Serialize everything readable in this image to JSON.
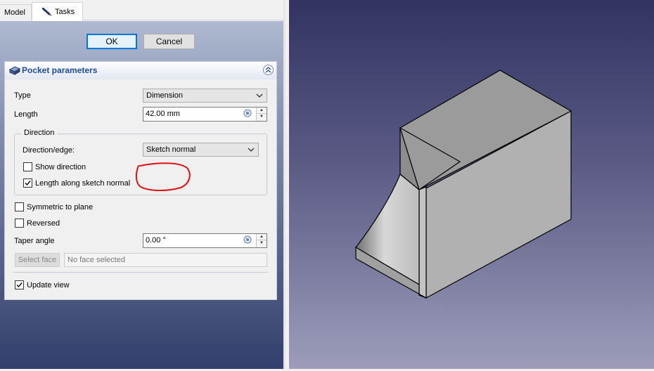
{
  "tabs": {
    "model_label": "Model",
    "tasks_label": "Tasks"
  },
  "dialog": {
    "ok_label": "OK",
    "cancel_label": "Cancel"
  },
  "pocket": {
    "title": "Pocket parameters",
    "type_label": "Type",
    "type_value": "Dimension",
    "length_label": "Length",
    "length_value": "42.00 mm",
    "direction_group_label": "Direction",
    "direction_edge_label": "Direction/edge:",
    "direction_edge_value": "Sketch normal",
    "show_direction_label": "Show direction",
    "show_direction_checked": false,
    "length_along_normal_label": "Length along sketch normal",
    "length_along_normal_checked": true,
    "symmetric_label": "Symmetric to plane",
    "symmetric_checked": false,
    "reversed_label": "Reversed",
    "reversed_checked": false,
    "taper_label": "Taper angle",
    "taper_value": "0.00 °",
    "select_face_label": "Select face",
    "face_placeholder": "No face selected",
    "update_view_label": "Update view",
    "update_view_checked": true
  },
  "icons": [
    "pencil-icon",
    "pocket-icon",
    "collapse-icon",
    "expression-icon",
    "dropdown-arrow-icon"
  ],
  "colors": {
    "title_blue": "#1d4ea0",
    "annotation_red": "#e01010",
    "model_face": "#9a9a9a"
  }
}
